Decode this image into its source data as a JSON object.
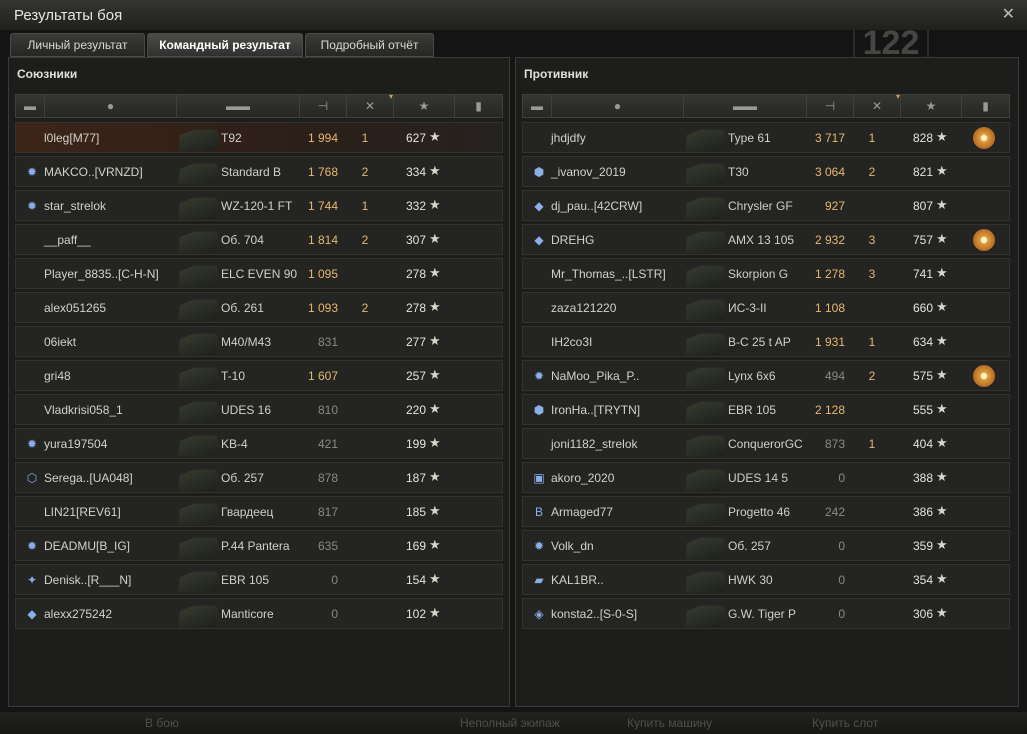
{
  "window": {
    "title": "Результаты боя",
    "bg_level": "122"
  },
  "tabs": [
    {
      "label": "Личный результат"
    },
    {
      "label": "Командный результат"
    },
    {
      "label": "Подробный отчёт"
    }
  ],
  "columns": {
    "sort_indicator": "▾"
  },
  "allies": {
    "title": "Союзники",
    "rows": [
      {
        "badge": "",
        "player": "l0leg[M77]",
        "self": true,
        "vehicle": "T92",
        "damage": "1 994",
        "kills": "1",
        "xp": "627",
        "medal": false
      },
      {
        "badge": "✹",
        "player": "MAKCO..[VRNZD]",
        "self": false,
        "vehicle": "Standard B",
        "damage": "1 768",
        "kills": "2",
        "xp": "334",
        "medal": false
      },
      {
        "badge": "✹",
        "player": "star_strelok",
        "self": false,
        "vehicle": "WZ-120-1 FT",
        "damage": "1 744",
        "kills": "1",
        "xp": "332",
        "medal": false
      },
      {
        "badge": "",
        "player": "__paff__",
        "self": false,
        "vehicle": "Об. 704",
        "damage": "1 814",
        "kills": "2",
        "xp": "307",
        "medal": false
      },
      {
        "badge": "",
        "player": "Player_8835..[C-H-N]",
        "self": false,
        "vehicle": "ELC EVEN 90",
        "damage": "1 095",
        "kills": "",
        "xp": "278",
        "medal": false
      },
      {
        "badge": "",
        "player": "alex051265",
        "self": false,
        "vehicle": "Об. 261",
        "damage": "1 093",
        "kills": "2",
        "xp": "278",
        "medal": false
      },
      {
        "badge": "",
        "player": "06iekt",
        "self": false,
        "vehicle": "M40/M43",
        "damage": "831",
        "kills": "",
        "xp": "277",
        "medal": false
      },
      {
        "badge": "",
        "player": "gri48",
        "self": false,
        "vehicle": "T-10",
        "damage": "1 607",
        "kills": "",
        "xp": "257",
        "medal": false
      },
      {
        "badge": "",
        "player": "Vladkrisi058_1",
        "self": false,
        "vehicle": "UDES 16",
        "damage": "810",
        "kills": "",
        "xp": "220",
        "medal": false
      },
      {
        "badge": "✹",
        "player": "yura197504",
        "self": false,
        "vehicle": "KB-4",
        "damage": "421",
        "kills": "",
        "xp": "199",
        "medal": false
      },
      {
        "badge": "⬡",
        "player": "Serega..[UA048]",
        "self": false,
        "vehicle": "Об. 257",
        "damage": "878",
        "kills": "",
        "xp": "187",
        "medal": false
      },
      {
        "badge": "",
        "player": "LIN21[REV61]",
        "self": false,
        "vehicle": "Гвардеец",
        "damage": "817",
        "kills": "",
        "xp": "185",
        "medal": false
      },
      {
        "badge": "✹",
        "player": "DEADMU[B_IG]",
        "self": false,
        "vehicle": "P.44 Pantera",
        "damage": "635",
        "kills": "",
        "xp": "169",
        "medal": false
      },
      {
        "badge": "✦",
        "player": "Denisk..[R___N]",
        "self": false,
        "vehicle": "EBR 105",
        "damage": "0",
        "kills": "",
        "xp": "154",
        "medal": false
      },
      {
        "badge": "◆",
        "player": "alexx275242",
        "self": false,
        "vehicle": "Manticore",
        "damage": "0",
        "kills": "",
        "xp": "102",
        "medal": false
      }
    ]
  },
  "enemies": {
    "title": "Противник",
    "rows": [
      {
        "badge": "",
        "player": "jhdjdfy",
        "vehicle": "Type 61",
        "damage": "3 717",
        "kills": "1",
        "xp": "828",
        "medal": true
      },
      {
        "badge": "⬢",
        "player": "_ivanov_2019",
        "vehicle": "T30",
        "damage": "3 064",
        "kills": "2",
        "xp": "821",
        "medal": false
      },
      {
        "badge": "◆",
        "player": "dj_pau..[42CRW]",
        "vehicle": "Chrysler GF",
        "damage": "927",
        "kills": "",
        "xp": "807",
        "medal": false
      },
      {
        "badge": "◆",
        "player": "DREHG",
        "vehicle": "AMX 13 105",
        "damage": "2 932",
        "kills": "3",
        "xp": "757",
        "medal": true
      },
      {
        "badge": "",
        "player": "Mr_Thomas_..[LSTR]",
        "vehicle": "Skorpion G",
        "damage": "1 278",
        "kills": "3",
        "xp": "741",
        "medal": false
      },
      {
        "badge": "",
        "player": "zaza121220",
        "vehicle": "ИС-3-II",
        "damage": "1 108",
        "kills": "",
        "xp": "660",
        "medal": false
      },
      {
        "badge": "",
        "player": "IH2co3I",
        "vehicle": "B-C 25 t AP",
        "damage": "1 931",
        "kills": "1",
        "xp": "634",
        "medal": false
      },
      {
        "badge": "✹",
        "player": "NaMoo_Pika_P..",
        "vehicle": "Lynx 6x6",
        "damage": "494",
        "kills": "2",
        "xp": "575",
        "medal": true
      },
      {
        "badge": "⬢",
        "player": "IronHa..[TRYTN]",
        "vehicle": "EBR 105",
        "damage": "2 128",
        "kills": "",
        "xp": "555",
        "medal": false
      },
      {
        "badge": "",
        "player": "joni1182_strelok",
        "vehicle": "ConquerorGC",
        "damage": "873",
        "kills": "1",
        "xp": "404",
        "medal": false
      },
      {
        "badge": "▣",
        "player": "akoro_2020",
        "vehicle": "UDES 14 5",
        "damage": "0",
        "kills": "",
        "xp": "388",
        "medal": false
      },
      {
        "badge": "B",
        "player": "Armaged77",
        "vehicle": "Progetto 46",
        "damage": "242",
        "kills": "",
        "xp": "386",
        "medal": false
      },
      {
        "badge": "✹",
        "player": "Volk_dn",
        "vehicle": "Об. 257",
        "damage": "0",
        "kills": "",
        "xp": "359",
        "medal": false
      },
      {
        "badge": "▰",
        "player": "KAL1BR..",
        "vehicle": "HWK 30",
        "damage": "0",
        "kills": "",
        "xp": "354",
        "medal": false
      },
      {
        "badge": "◈",
        "player": "konsta2..[S-0-S]",
        "vehicle": "G.W. Tiger P",
        "damage": "0",
        "kills": "",
        "xp": "306",
        "medal": false
      }
    ]
  },
  "bottom": {
    "to_battle": "В бою",
    "incomplete_crew": "Неполный экипаж",
    "buy_vehicle": "Купить машину",
    "buy_slot": "Купить слот"
  },
  "colors": {
    "damage_high": "#e6b870",
    "damage_low": "#8a8a82",
    "self_row": "#3d2418",
    "medal": "#f3b64c"
  }
}
